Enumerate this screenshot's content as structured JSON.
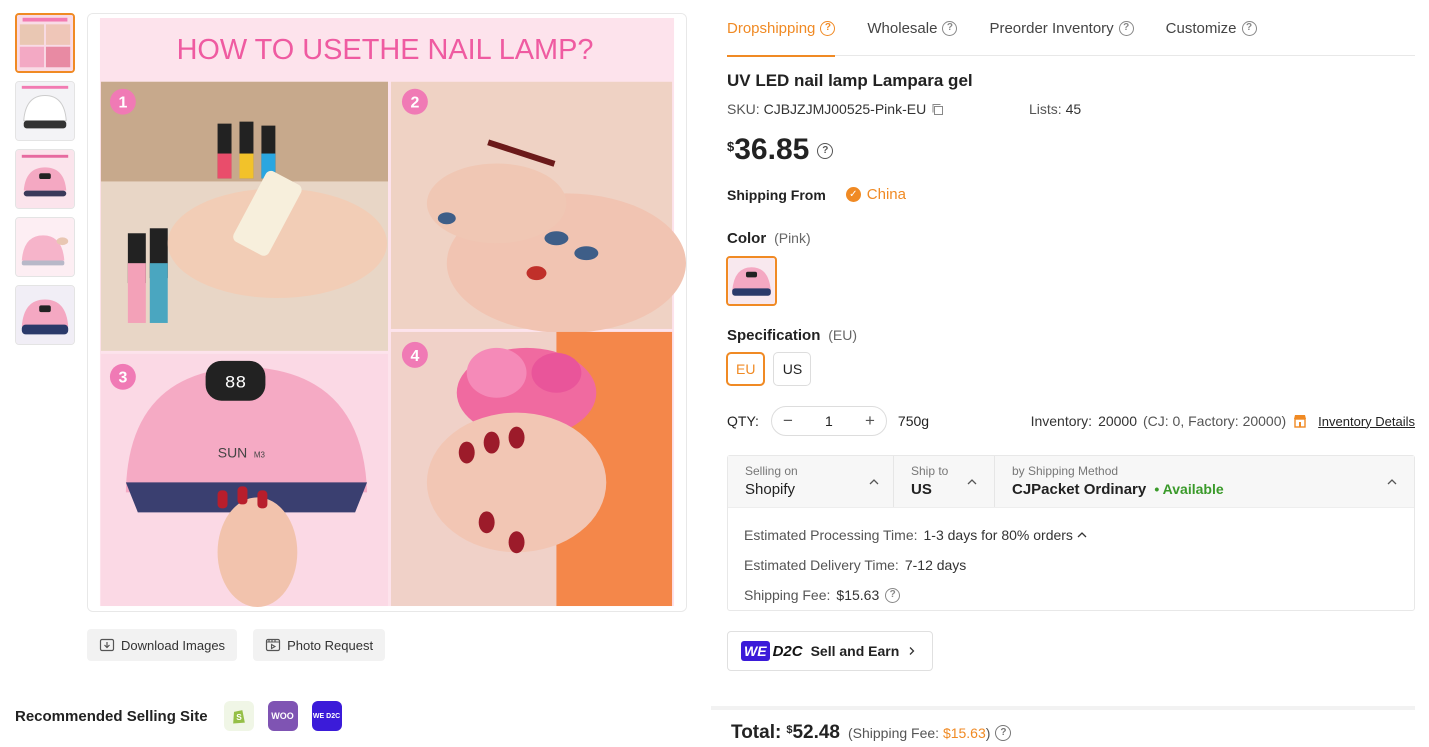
{
  "thumbnails": [
    {
      "name": "how-to-use",
      "color": "#f4c9d8"
    },
    {
      "name": "lamp-white",
      "color": "#eef0f3"
    },
    {
      "name": "lamp-pink-info",
      "color": "#fbe1ea"
    },
    {
      "name": "lamp-pink-hand",
      "color": "#f7d4e0"
    },
    {
      "name": "lamp-dark",
      "color": "#e8e4f0"
    }
  ],
  "main_image": {
    "heading": "HOW TO USETHE NAIL LAMP?",
    "steps": [
      "1",
      "2",
      "3",
      "4"
    ],
    "lamp_display": "88",
    "lamp_brand": "SUN",
    "lamp_model": "M3"
  },
  "image_actions": {
    "download": "Download Images",
    "photo_request": "Photo Request"
  },
  "recommended": {
    "label": "Recommended Selling Site",
    "sites": [
      {
        "name": "shopify",
        "text": "S",
        "color": "#95bf47"
      },
      {
        "name": "woo",
        "text": "WOO",
        "color": "#7f54b3"
      },
      {
        "name": "we-d2c",
        "text": "WE D2C",
        "color": "#3b1bd9"
      }
    ]
  },
  "tabs": [
    {
      "label": "Dropshipping",
      "active": true
    },
    {
      "label": "Wholesale",
      "active": false
    },
    {
      "label": "Preorder Inventory",
      "active": false
    },
    {
      "label": "Customize",
      "active": false
    }
  ],
  "product": {
    "title": "UV LED nail lamp Lampara gel",
    "sku_label": "SKU:",
    "sku": "CJBJZJMJ00525-Pink-EU",
    "lists_label": "Lists:",
    "lists": "45",
    "currency": "$",
    "price": "36.85"
  },
  "shipping_from": {
    "label": "Shipping From",
    "value": "China"
  },
  "color": {
    "label": "Color",
    "selected": "(Pink)"
  },
  "specification": {
    "label": "Specification",
    "selected": "(EU)",
    "options": [
      "EU",
      "US"
    ]
  },
  "qty": {
    "label": "QTY:",
    "value": "1",
    "minus": "−",
    "plus": "+",
    "weight": "750g",
    "inventory_label": "Inventory:",
    "inventory": "20000",
    "inventory_breakdown": "(CJ: 0, Factory: 20000)",
    "inventory_link": "Inventory Details"
  },
  "shipping": {
    "selling_on_label": "Selling on",
    "selling_on": "Shopify",
    "ship_to_label": "Ship to",
    "ship_to": "US",
    "method_label": "by Shipping Method",
    "method": "CJPacket Ordinary",
    "availability": "• Available",
    "processing_label": "Estimated Processing Time:",
    "processing": "1-3 days for 80% orders",
    "delivery_label": "Estimated Delivery Time:",
    "delivery": "7-12 days",
    "fee_label": "Shipping Fee:",
    "fee": "$15.63"
  },
  "we_d2c": {
    "we": "WE",
    "d2c": "D2C",
    "label": "Sell and Earn"
  },
  "total": {
    "label": "Total:",
    "currency": "$",
    "amount": "52.48",
    "fee_prefix": "(Shipping Fee:",
    "fee": "$15.63",
    "fee_suffix": ")"
  },
  "colors": {
    "accent": "#f08a24",
    "available": "#3a9a2a"
  }
}
